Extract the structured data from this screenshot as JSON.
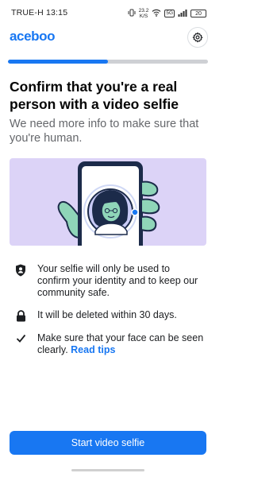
{
  "status_bar": {
    "carrier_time": "TRUE-H 13:15",
    "net_speed_value": "23.2",
    "net_speed_unit": "K/S",
    "network_type": "5G",
    "battery": "20"
  },
  "header": {
    "logo": "aceboo",
    "settings_icon": "gear-icon"
  },
  "progress": {
    "value_fraction": 0.5
  },
  "content": {
    "title": "Confirm that you're a real person with a video selfie",
    "subtitle": "We need more info to make sure that you're human."
  },
  "bullets": [
    {
      "icon": "shield-person-icon",
      "text": "Your selfie will only be used to confirm your identity and to keep our community safe."
    },
    {
      "icon": "lock-icon",
      "text": "It will be deleted within 30 days."
    },
    {
      "icon": "checkmark-icon",
      "text": "Make sure that your face can be seen clearly.",
      "link": "Read tips"
    }
  ],
  "cta": {
    "label": "Start video selfie"
  },
  "colors": {
    "brand": "#1877f2",
    "illustration_bg": "#dcd3f7",
    "progress_track": "#ced0d4"
  }
}
